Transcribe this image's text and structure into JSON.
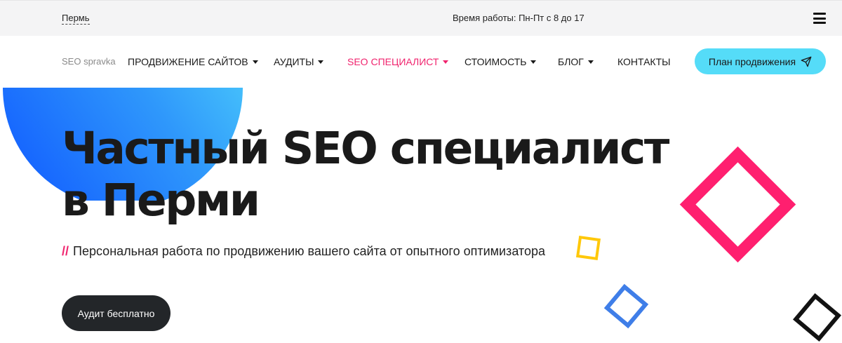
{
  "topbar": {
    "city": "Пермь",
    "hours": "Время работы: Пн-Пт с 8 до 17",
    "menu_icon": "hamburger-menu-icon"
  },
  "nav": {
    "logo": "SEO spravka",
    "items": [
      {
        "label": "ПРОДВИЖЕНИЕ САЙТОВ",
        "has_dropdown": true
      },
      {
        "label": "АУДИТЫ",
        "has_dropdown": true
      },
      {
        "label": "SEO СПЕЦИАЛИСТ",
        "has_dropdown": true,
        "active": true
      },
      {
        "label": "СТОИМОСТЬ",
        "has_dropdown": true
      },
      {
        "label": "БЛОГ",
        "has_dropdown": true
      },
      {
        "label": "КОНТАКТЫ",
        "has_dropdown": false
      }
    ],
    "cta_label": "План продвижения",
    "cta_icon": "paper-plane-icon"
  },
  "hero": {
    "title_line1": "Частный SEO специалист",
    "title_line2": "в Перми",
    "subtitle_prefix": "//",
    "subtitle": "Персональная работа по продвижению вашего сайта от опытного оптимизатора",
    "button_label": "Аудит бесплатно"
  },
  "colors": {
    "accent_pink": "#f0246e",
    "cta_cyan": "#55dcf8",
    "dark_button": "#232629",
    "gradient_start": "#55ddfb",
    "gradient_end": "#0f57ff",
    "square_yellow": "#ffc80a",
    "square_blue": "#3f7ee8"
  }
}
